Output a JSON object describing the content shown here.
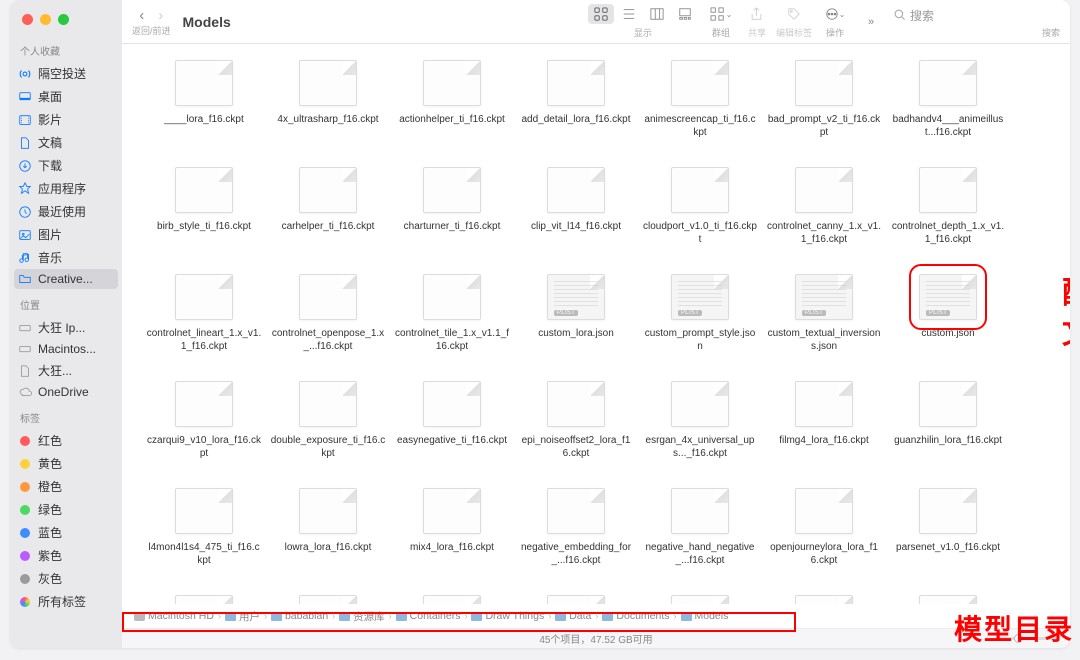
{
  "window": {
    "title": "Models",
    "nav_sub": "返回/前进"
  },
  "toolbar": {
    "view_label": "显示",
    "group_label": "群组",
    "share_label": "共享",
    "edit_tags_label": "编辑标签",
    "actions_label": "操作",
    "search_placeholder": "搜索",
    "search_sub": "搜索"
  },
  "sidebar": {
    "favorites_header": "个人收藏",
    "favorites": [
      {
        "icon": "airdrop",
        "label": "隔空投送",
        "color": "blue"
      },
      {
        "icon": "desktop",
        "label": "桌面",
        "color": "blue"
      },
      {
        "icon": "movies",
        "label": "影片",
        "color": "blue"
      },
      {
        "icon": "documents",
        "label": "文稿",
        "color": "blue"
      },
      {
        "icon": "downloads",
        "label": "下载",
        "color": "blue"
      },
      {
        "icon": "apps",
        "label": "应用程序",
        "color": "blue"
      },
      {
        "icon": "recents",
        "label": "最近使用",
        "color": "blue"
      },
      {
        "icon": "pictures",
        "label": "图片",
        "color": "blue"
      },
      {
        "icon": "music",
        "label": "音乐",
        "color": "blue"
      },
      {
        "icon": "folder",
        "label": "Creative...",
        "color": "blue",
        "selected": true
      }
    ],
    "locations_header": "位置",
    "locations": [
      {
        "icon": "disk",
        "label": "大狂 Ip..."
      },
      {
        "icon": "disk",
        "label": "Macintos..."
      },
      {
        "icon": "doc",
        "label": "大狂..."
      },
      {
        "icon": "cloud",
        "label": "OneDrive"
      }
    ],
    "tags_header": "标签",
    "tags": [
      {
        "color": "#ff5b5b",
        "label": "红色"
      },
      {
        "color": "#ffcf3f",
        "label": "黄色"
      },
      {
        "color": "#ff9640",
        "label": "橙色"
      },
      {
        "color": "#4cd964",
        "label": "绿色"
      },
      {
        "color": "#3f8cff",
        "label": "蓝色"
      },
      {
        "color": "#bb5bff",
        "label": "紫色"
      },
      {
        "color": "#9a9a9a",
        "label": "灰色"
      }
    ],
    "all_tags": "所有标签"
  },
  "files": [
    {
      "name": "____lora_f16.ckpt",
      "type": "ckpt"
    },
    {
      "name": "4x_ultrasharp_f16.ckpt",
      "type": "ckpt"
    },
    {
      "name": "actionhelper_ti_f16.ckpt",
      "type": "ckpt"
    },
    {
      "name": "add_detail_lora_f16.ckpt",
      "type": "ckpt"
    },
    {
      "name": "animescreencap_ti_f16.ckpt",
      "type": "ckpt"
    },
    {
      "name": "bad_prompt_v2_ti_f16.ckpt",
      "type": "ckpt"
    },
    {
      "name": "badhandv4___animeillust...f16.ckpt",
      "type": "ckpt"
    },
    {
      "name": "birb_style_ti_f16.ckpt",
      "type": "ckpt"
    },
    {
      "name": "carhelper_ti_f16.ckpt",
      "type": "ckpt"
    },
    {
      "name": "charturner_ti_f16.ckpt",
      "type": "ckpt"
    },
    {
      "name": "clip_vit_l14_f16.ckpt",
      "type": "ckpt"
    },
    {
      "name": "cloudport_v1.0_ti_f16.ckpt",
      "type": "ckpt"
    },
    {
      "name": "controlnet_canny_1.x_v1.1_f16.ckpt",
      "type": "ckpt"
    },
    {
      "name": "controlnet_depth_1.x_v1.1_f16.ckpt",
      "type": "ckpt"
    },
    {
      "name": "controlnet_lineart_1.x_v1.1_f16.ckpt",
      "type": "ckpt"
    },
    {
      "name": "controlnet_openpose_1.x_...f16.ckpt",
      "type": "ckpt"
    },
    {
      "name": "controlnet_tile_1.x_v1.1_f16.ckpt",
      "type": "ckpt"
    },
    {
      "name": "custom_lora.json",
      "type": "plist"
    },
    {
      "name": "custom_prompt_style.json",
      "type": "plist"
    },
    {
      "name": "custom_textual_inversions.json",
      "type": "plist"
    },
    {
      "name": "custom.json",
      "type": "plist",
      "highlight": true
    },
    {
      "name": "czarqui9_v10_lora_f16.ckpt",
      "type": "ckpt"
    },
    {
      "name": "double_exposure_ti_f16.ckpt",
      "type": "ckpt"
    },
    {
      "name": "easynegative_ti_f16.ckpt",
      "type": "ckpt"
    },
    {
      "name": "epi_noiseoffset2_lora_f16.ckpt",
      "type": "ckpt"
    },
    {
      "name": "esrgan_4x_universal_ups..._f16.ckpt",
      "type": "ckpt"
    },
    {
      "name": "filmg4_lora_f16.ckpt",
      "type": "ckpt"
    },
    {
      "name": "guanzhilin_lora_f16.ckpt",
      "type": "ckpt"
    },
    {
      "name": "l4mon4l1s4_475_ti_f16.ckpt",
      "type": "ckpt"
    },
    {
      "name": "lowra_lora_f16.ckpt",
      "type": "ckpt"
    },
    {
      "name": "mix4_lora_f16.ckpt",
      "type": "ckpt"
    },
    {
      "name": "negative_embedding_for_...f16.ckpt",
      "type": "ckpt"
    },
    {
      "name": "negative_hand_negative_...f16.ckpt",
      "type": "ckpt"
    },
    {
      "name": "openjourneylora_lora_f16.ckpt",
      "type": "ckpt"
    },
    {
      "name": "parsenet_v1.0_f16.ckpt",
      "type": "ckpt"
    },
    {
      "name": "",
      "type": "ckpt"
    },
    {
      "name": "",
      "type": "ckpt"
    },
    {
      "name": "",
      "type": "ckpt"
    },
    {
      "name": "",
      "type": "ckpt"
    },
    {
      "name": "",
      "type": "ckpt"
    },
    {
      "name": "",
      "type": "ckpt"
    },
    {
      "name": "",
      "type": "ckpt"
    }
  ],
  "breadcrumbs": [
    {
      "label": "Macintosh HD",
      "kind": "hd"
    },
    {
      "label": "用户",
      "kind": "folder"
    },
    {
      "label": "bababian",
      "kind": "folder"
    },
    {
      "label": "资源库",
      "kind": "folder"
    },
    {
      "label": "Containers",
      "kind": "folder"
    },
    {
      "label": "Draw Things",
      "kind": "folder"
    },
    {
      "label": "Data",
      "kind": "folder"
    },
    {
      "label": "Documents",
      "kind": "folder"
    },
    {
      "label": "Models",
      "kind": "folder"
    }
  ],
  "status": "45个项目，47.52 GB可用",
  "annotations": {
    "config_file_1": "配置",
    "config_file_2": "文件",
    "model_dir": "模型目录"
  }
}
